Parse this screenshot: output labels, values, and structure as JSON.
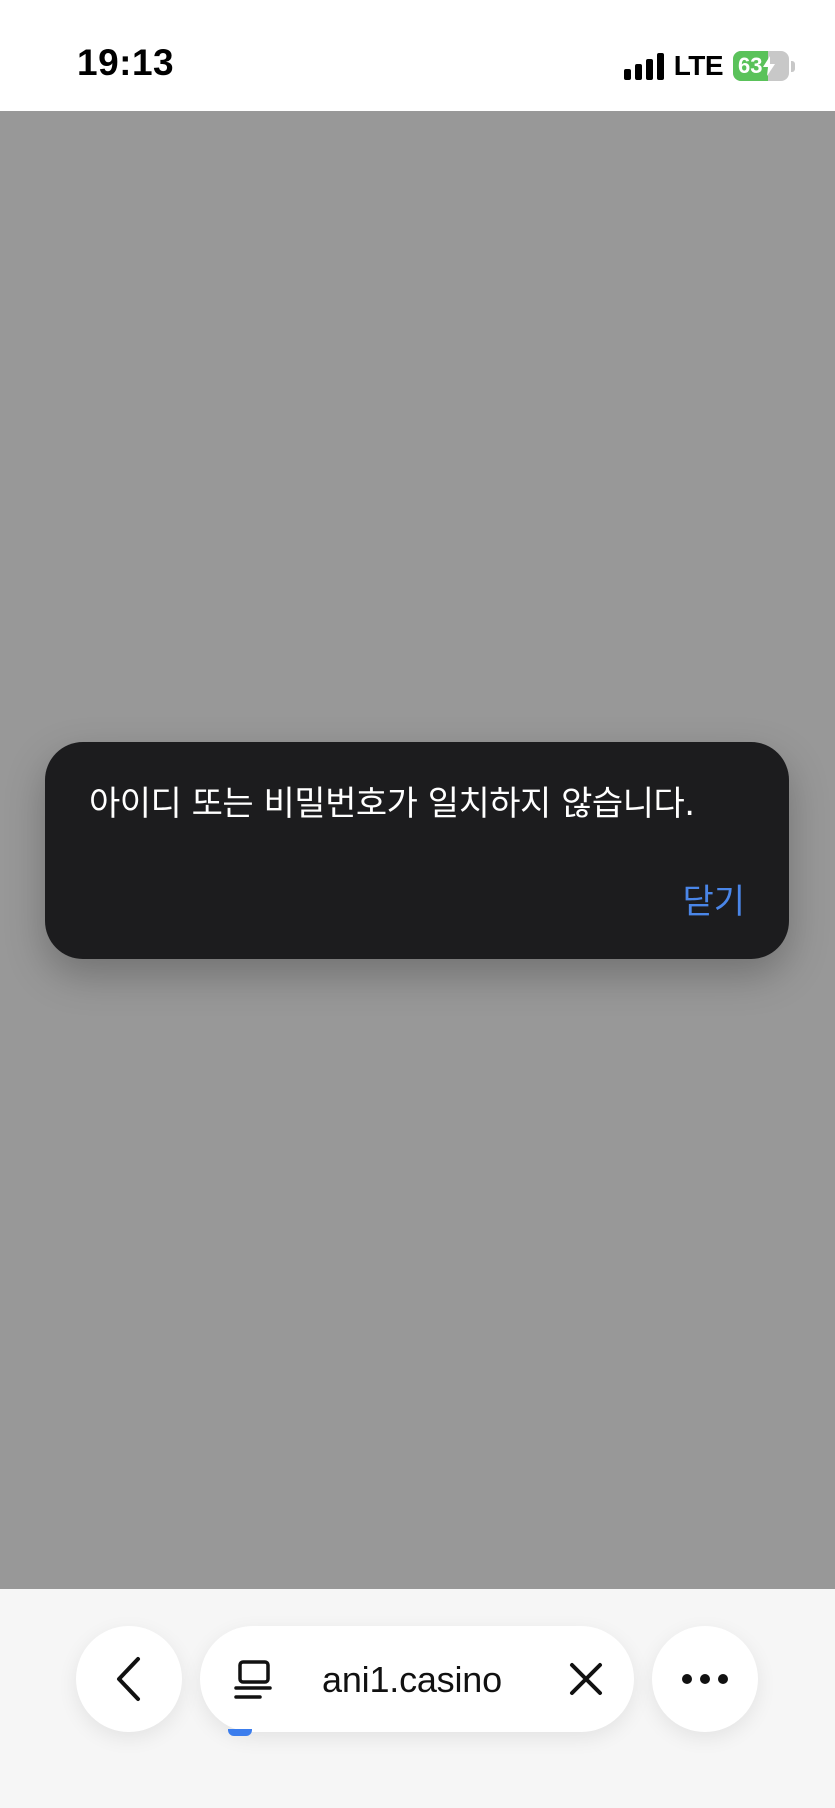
{
  "status_bar": {
    "time": "19:13",
    "network": "LTE",
    "battery_level": "63",
    "battery_fraction": 0.63,
    "battery_charging": true,
    "battery_color": "#5ac25a"
  },
  "alert": {
    "message": "아이디 또는 비밀번호가 일치하지 않습니다.",
    "close_label": "닫기",
    "close_color": "#4a86e8"
  },
  "browser": {
    "url": "ani1.casino",
    "back_icon": "chevron-left-icon",
    "tabs_icon": "tabs-icon",
    "clear_icon": "close-icon",
    "more_icon": "ellipsis-icon"
  },
  "colors": {
    "overlay": "#989898",
    "alert_bg": "#1c1c1e"
  }
}
